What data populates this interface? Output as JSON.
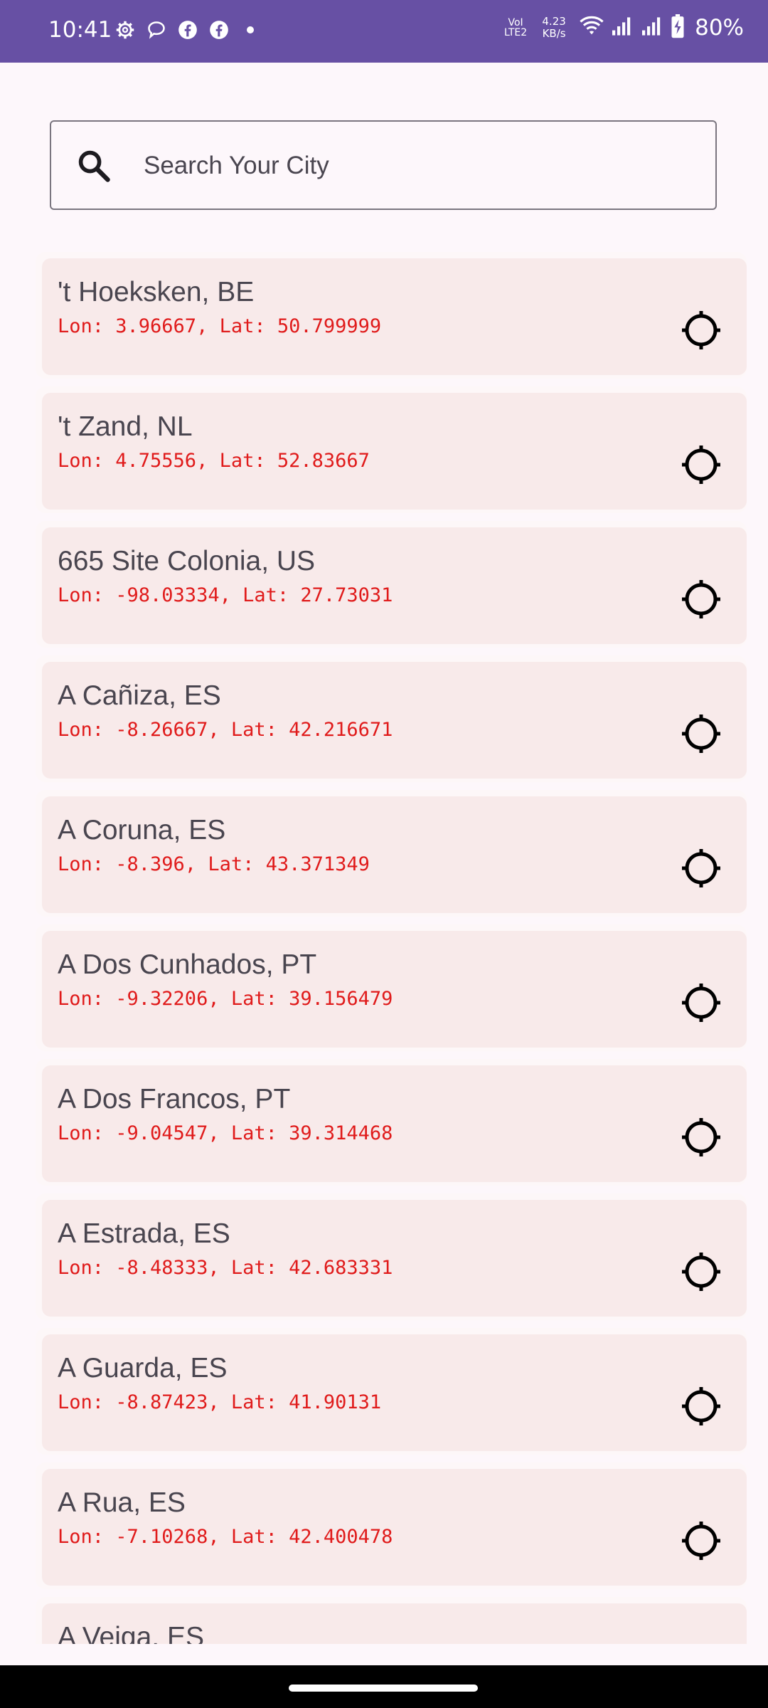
{
  "status_bar": {
    "time": "10:41",
    "left_icons": [
      "settings-icon",
      "chat-bubble-icon",
      "facebook-icon",
      "facebook-icon",
      "notification-dot-icon"
    ],
    "volte_line1": "VoI",
    "volte_line2": "LTE2",
    "speed_value": "4.23",
    "speed_unit": "KB/s",
    "battery": "80%"
  },
  "search": {
    "placeholder": "Search Your City",
    "value": ""
  },
  "cities": [
    {
      "name": "'t Hoeksken, BE",
      "coords": "Lon: 3.96667, Lat: 50.799999"
    },
    {
      "name": "'t Zand, NL",
      "coords": "Lon: 4.75556, Lat: 52.83667"
    },
    {
      "name": "665 Site Colonia, US",
      "coords": "Lon: -98.03334, Lat: 27.73031"
    },
    {
      "name": "A Cañiza, ES",
      "coords": "Lon: -8.26667, Lat: 42.216671"
    },
    {
      "name": "A Coruna, ES",
      "coords": "Lon: -8.396, Lat: 43.371349"
    },
    {
      "name": "A Dos Cunhados, PT",
      "coords": "Lon: -9.32206, Lat: 39.156479"
    },
    {
      "name": "A Dos Francos, PT",
      "coords": "Lon: -9.04547, Lat: 39.314468"
    },
    {
      "name": "A Estrada, ES",
      "coords": "Lon: -8.48333, Lat: 42.683331"
    },
    {
      "name": "A Guarda, ES",
      "coords": "Lon: -8.87423, Lat: 41.90131"
    },
    {
      "name": "A Rua, ES",
      "coords": "Lon: -7.10268, Lat: 42.400478"
    },
    {
      "name": "A Veiga, ES",
      "coords": ""
    }
  ],
  "colors": {
    "status_bar": "#6750a4",
    "card": "#f8eaea",
    "coords_text": "#e01b1b",
    "name_text": "#49454f"
  }
}
